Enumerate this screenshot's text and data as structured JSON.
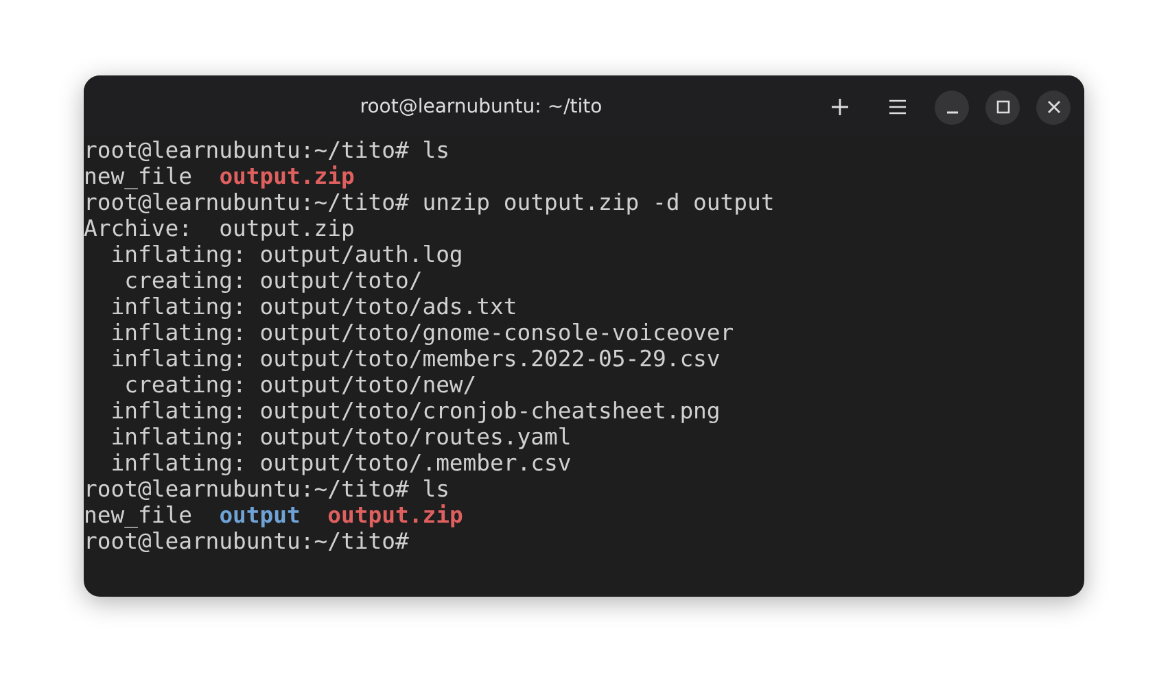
{
  "window": {
    "title": "root@learnubuntu: ~/tito"
  },
  "terminal": {
    "lines": [
      {
        "kind": "text",
        "text": "root@learnubuntu:~/tito# ls"
      },
      {
        "kind": "listing",
        "entries": [
          {
            "name": "new_file",
            "kind": "file"
          },
          {
            "name": "output.zip",
            "kind": "archive"
          }
        ]
      },
      {
        "kind": "text",
        "text": "root@learnubuntu:~/tito# unzip output.zip -d output"
      },
      {
        "kind": "text",
        "text": "Archive:  output.zip"
      },
      {
        "kind": "text",
        "text": "  inflating: output/auth.log"
      },
      {
        "kind": "text",
        "text": "   creating: output/toto/"
      },
      {
        "kind": "text",
        "text": "  inflating: output/toto/ads.txt"
      },
      {
        "kind": "text",
        "text": "  inflating: output/toto/gnome-console-voiceover"
      },
      {
        "kind": "text",
        "text": "  inflating: output/toto/members.2022-05-29.csv"
      },
      {
        "kind": "text",
        "text": "   creating: output/toto/new/"
      },
      {
        "kind": "text",
        "text": "  inflating: output/toto/cronjob-cheatsheet.png"
      },
      {
        "kind": "text",
        "text": "  inflating: output/toto/routes.yaml"
      },
      {
        "kind": "text",
        "text": "  inflating: output/toto/.member.csv"
      },
      {
        "kind": "text",
        "text": "root@learnubuntu:~/tito# ls"
      },
      {
        "kind": "listing",
        "entries": [
          {
            "name": "new_file",
            "kind": "file"
          },
          {
            "name": "output",
            "kind": "directory"
          },
          {
            "name": "output.zip",
            "kind": "archive"
          }
        ]
      },
      {
        "kind": "text",
        "text": "root@learnubuntu:~/tito#"
      }
    ]
  }
}
